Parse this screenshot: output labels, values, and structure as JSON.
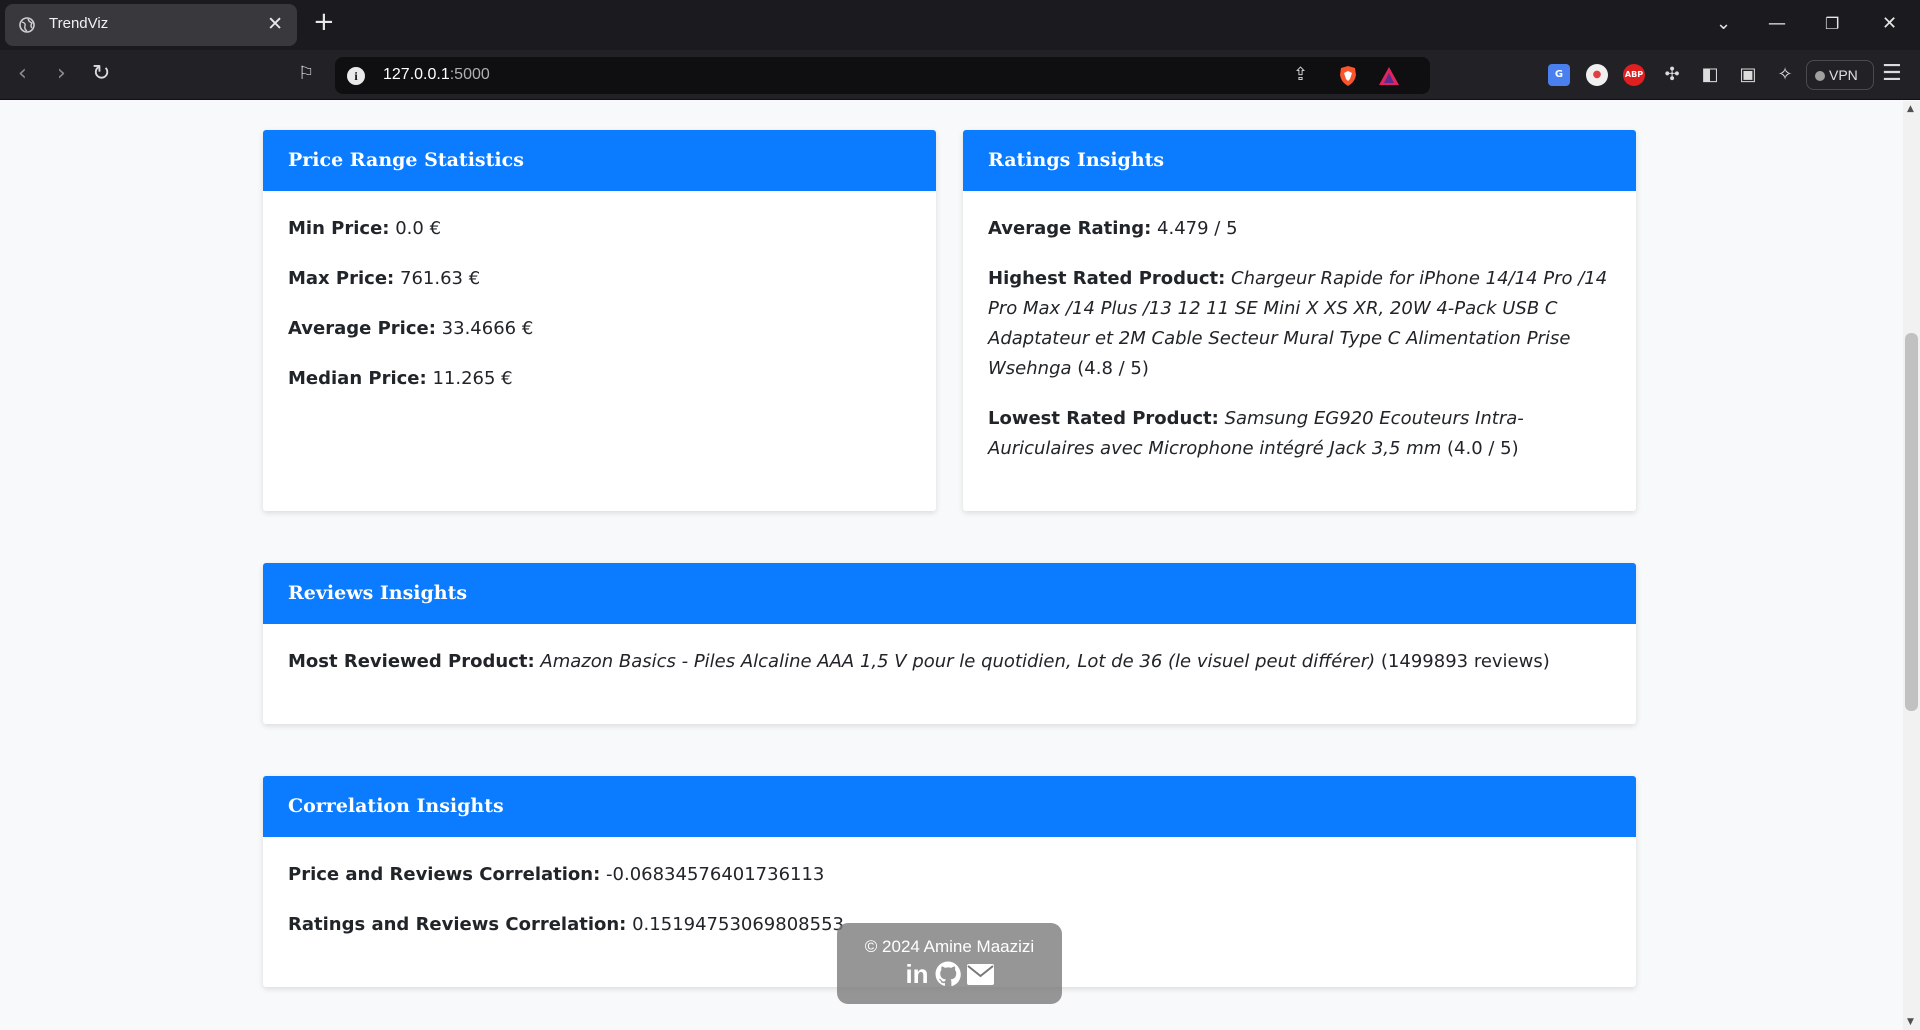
{
  "browser": {
    "tab_title": "TrendViz",
    "url_host": "127.0.0.1",
    "url_port": ":5000",
    "vpn_label": "VPN",
    "abp_label": "ABP"
  },
  "price_card": {
    "title": "Price Range Statistics",
    "rows": [
      {
        "label": "Min Price:",
        "value": "0.0 €"
      },
      {
        "label": "Max Price:",
        "value": "761.63 €"
      },
      {
        "label": "Average Price:",
        "value": "33.4666 €"
      },
      {
        "label": "Median Price:",
        "value": "11.265 €"
      }
    ]
  },
  "ratings_card": {
    "title": "Ratings Insights",
    "average": {
      "label": "Average Rating:",
      "value": "4.479 / 5"
    },
    "highest": {
      "label": "Highest Rated Product:",
      "product": "Chargeur Rapide for iPhone 14/14 Pro /14 Pro Max /14 Plus /13 12 11 SE Mini X XS XR, 20W 4-Pack USB C Adaptateur et 2M Cable Secteur Mural Type C Alimentation Prise Wsehnga",
      "score": "(4.8 / 5)"
    },
    "lowest": {
      "label": "Lowest Rated Product:",
      "product": "Samsung EG920 Ecouteurs Intra-Auriculaires avec Microphone intégré Jack 3,5 mm",
      "score": "(4.0 / 5)"
    }
  },
  "reviews_card": {
    "title": "Reviews Insights",
    "most": {
      "label": "Most Reviewed Product:",
      "product": "Amazon Basics - Piles Alcaline AAA 1,5 V pour le quotidien, Lot de 36 (le visuel peut différer)",
      "count": "(1499893 reviews)"
    }
  },
  "correlation_card": {
    "title": "Correlation Insights",
    "rows": [
      {
        "label": "Price and Reviews Correlation:",
        "value": "-0.06834576401736113"
      },
      {
        "label": "Ratings and Reviews Correlation:",
        "value": "0.15194753069808553"
      }
    ]
  },
  "footer": {
    "copyright": "© 2024 Amine Maazizi",
    "linkedin_label": "in"
  },
  "colors": {
    "header_blue": "#0b7bff",
    "page_bg": "#f8f9fa"
  }
}
